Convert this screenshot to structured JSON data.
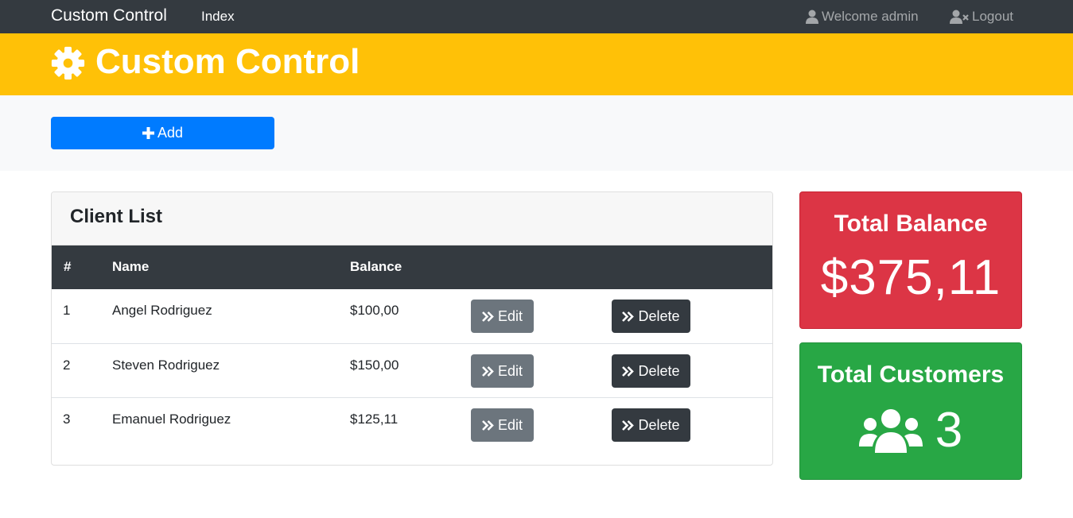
{
  "navbar": {
    "brand": "Custom Control",
    "index_link": "Index",
    "welcome": "Welcome admin",
    "logout": "Logout"
  },
  "header": {
    "title": "Custom Control",
    "icon": "gear-icon"
  },
  "actions": {
    "add_label": "Add",
    "add_icon": "plus-icon"
  },
  "client_list": {
    "title": "Client List",
    "columns": [
      "#",
      "Name",
      "Balance"
    ],
    "rows": [
      {
        "num": "1",
        "name": "Angel Rodriguez",
        "balance": "$100,00"
      },
      {
        "num": "2",
        "name": "Steven Rodriguez",
        "balance": "$150,00"
      },
      {
        "num": "3",
        "name": "Emanuel Rodriguez",
        "balance": "$125,11"
      }
    ],
    "edit_label": "Edit",
    "delete_label": "Delete"
  },
  "stats": {
    "balance_title": "Total Balance",
    "balance_value": "$375,11",
    "customers_title": "Total Customers",
    "customers_value": "3",
    "customers_icon": "users-icon"
  },
  "colors": {
    "navbar": "#343a40",
    "header": "#ffc107",
    "primary": "#007bff",
    "secondary": "#6c757d",
    "dark": "#343a40",
    "danger": "#dc3545",
    "success": "#28a745"
  }
}
